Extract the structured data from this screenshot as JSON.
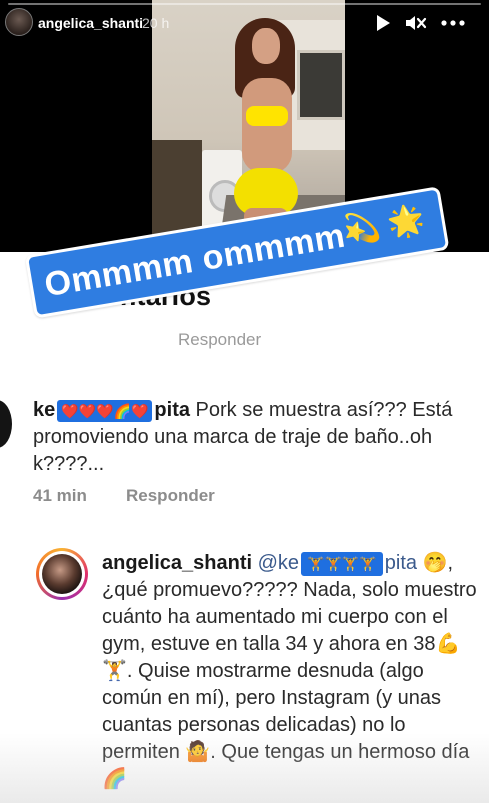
{
  "header": {
    "username": "angelica_shanti",
    "time": "20 h",
    "icons": [
      "play-icon",
      "mute-icon",
      "more-icon"
    ]
  },
  "comments_title": "Comentarios",
  "ghost_reply": "Responder",
  "sticker": {
    "text": "Ommmm ommmm",
    "emoji_1": "💫",
    "emoji_2": "🌟",
    "color": "#2f7de1"
  },
  "comment1": {
    "name": "ke",
    "name_end": "pita",
    "emoji_strip": "❤️❤️❤️🌈❤️",
    "text": " Pork se muestra así??? Está promoviendo una marca de traje de baño..oh k????...",
    "time": "41 min",
    "reply": "Responder"
  },
  "comment2": {
    "name": "angelica_shanti",
    "mention_start": "@ke",
    "mention_end": "pita",
    "emoji_strip": "🏋️🏋️🏋️🏋️",
    "text_1": " 🤭, ¿qué promuevo????? Nada, solo muestro cuánto ha aumentado mi cuerpo con el gym, estuve en talla 34 y ahora en 38💪🏋️. Quise mostrarme desnuda (algo común en mí), pero Instagram (y unas cuantas personas delicadas) no lo permiten 🤷. Que tengas un hermoso día 🌈"
  }
}
